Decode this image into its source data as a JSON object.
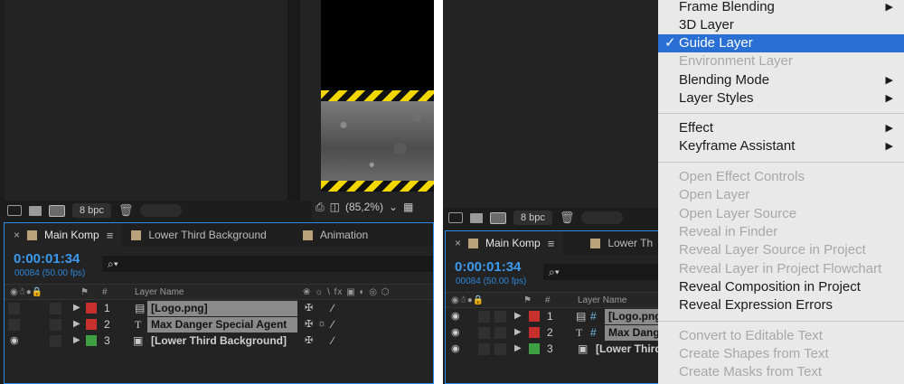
{
  "left": {
    "toolbar": {
      "bpc": "8 bpc"
    },
    "viewer": {
      "zoom": "(85,2%)"
    },
    "timeline": {
      "tabs": [
        {
          "label": "Main Komp",
          "active": true
        },
        {
          "label": "Lower Third Background",
          "active": false
        },
        {
          "label": "Animation",
          "active": false
        }
      ],
      "timecode": "0:00:01:34",
      "fps": "00084 (50.00 fps)",
      "search_icon": "⌕▾",
      "col_hash": "#",
      "col_layer_name": "Layer Name",
      "switch_icons": "❀ ☼ \\ fx ▣ ◐ ◎ ⬡",
      "layers": [
        {
          "num": "1",
          "name": "[Logo.png]",
          "type": "▤",
          "color": "#c8302e",
          "visible": false,
          "selected": true
        },
        {
          "num": "2",
          "name": "Max Danger Special Agent",
          "type": "T",
          "color": "#c8302e",
          "visible": false,
          "selected": true
        },
        {
          "num": "3",
          "name": "[Lower Third Background]",
          "type": "▣",
          "color": "#3ea043",
          "visible": true,
          "selected": false
        }
      ]
    }
  },
  "right": {
    "toolbar": {
      "bpc": "8 bpc"
    },
    "timeline": {
      "tabs": [
        {
          "label": "Main Komp",
          "active": true
        },
        {
          "label": "Lower Th",
          "active": false
        }
      ],
      "timecode": "0:00:01:34",
      "fps": "00084 (50.00 fps)",
      "search_icon": "⌕▾",
      "col_hash": "#",
      "col_layer_name": "Layer Name",
      "layers": [
        {
          "num": "1",
          "name": "[Logo.png]",
          "type": "▤",
          "color": "#c8302e",
          "visible": true
        },
        {
          "num": "2",
          "name": "Max Danger",
          "type": "T",
          "color": "#c8302e",
          "visible": true
        },
        {
          "num": "3",
          "name": "[Lower Third",
          "type": "▣",
          "color": "#3ea043",
          "visible": true
        }
      ]
    }
  },
  "context_menu": {
    "items": [
      {
        "label": "Frame Blending",
        "enabled": true,
        "submenu": true
      },
      {
        "label": "3D Layer",
        "enabled": true,
        "submenu": false
      },
      {
        "label": "Guide Layer",
        "enabled": true,
        "submenu": false,
        "checked": true,
        "highlighted": true
      },
      {
        "label": "Environment Layer",
        "enabled": false,
        "submenu": false
      },
      {
        "label": "Blending Mode",
        "enabled": true,
        "submenu": true
      },
      {
        "label": "Layer Styles",
        "enabled": true,
        "submenu": true
      },
      {
        "label": "Effect",
        "enabled": true,
        "submenu": true
      },
      {
        "label": "Keyframe Assistant",
        "enabled": true,
        "submenu": true
      },
      {
        "label": "Open Effect Controls",
        "enabled": false,
        "submenu": false
      },
      {
        "label": "Open Layer",
        "enabled": false,
        "submenu": false
      },
      {
        "label": "Open Layer Source",
        "enabled": false,
        "submenu": false
      },
      {
        "label": "Reveal in Finder",
        "enabled": false,
        "submenu": false
      },
      {
        "label": "Reveal Layer Source in Project",
        "enabled": false,
        "submenu": false
      },
      {
        "label": "Reveal Layer in Project Flowchart",
        "enabled": false,
        "submenu": false
      },
      {
        "label": "Reveal Composition in Project",
        "enabled": true,
        "submenu": false
      },
      {
        "label": "Reveal Expression Errors",
        "enabled": true,
        "submenu": false
      },
      {
        "label": "Convert to Editable Text",
        "enabled": false,
        "submenu": false
      },
      {
        "label": "Create Shapes from Text",
        "enabled": false,
        "submenu": false
      },
      {
        "label": "Create Masks from Text",
        "enabled": false,
        "submenu": false
      }
    ]
  },
  "colors": {
    "accent": "#2d8ceb",
    "highlight": "#2a6fd3",
    "label_red": "#c8302e",
    "label_green": "#3ea043"
  }
}
